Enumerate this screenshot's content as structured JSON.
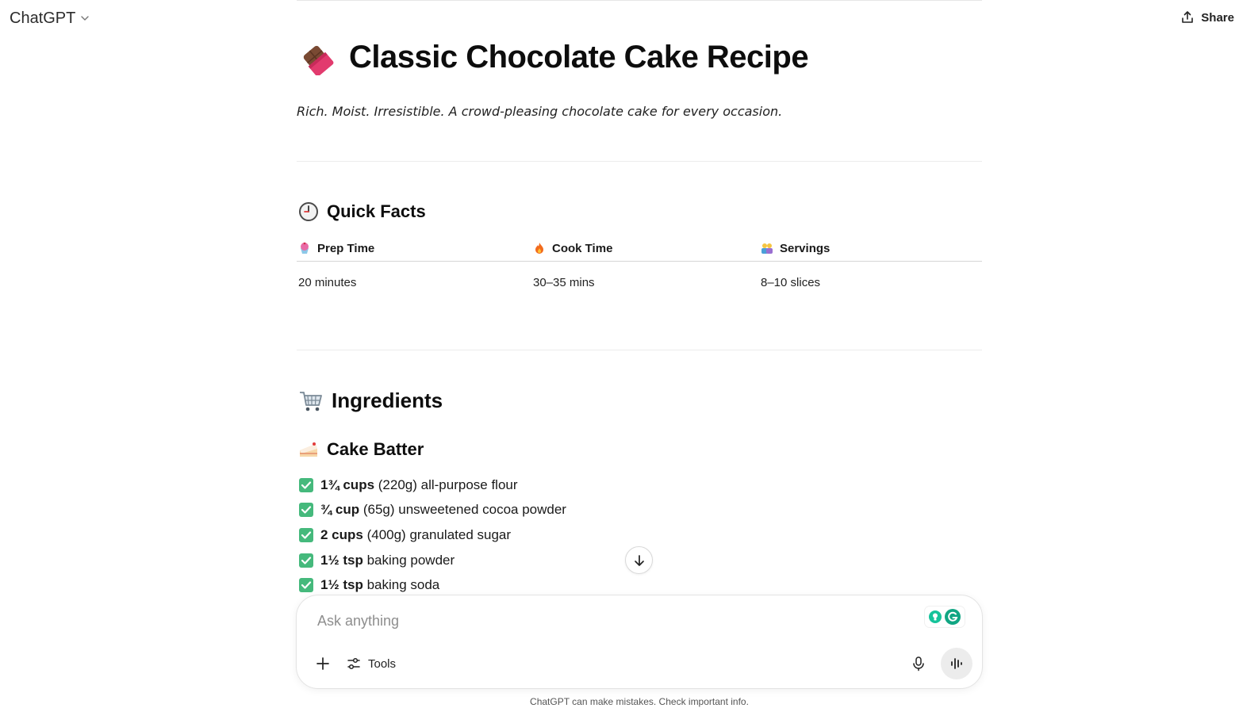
{
  "header": {
    "model_label": "ChatGPT",
    "share_label": "Share"
  },
  "doc": {
    "title": "Classic Chocolate Cake Recipe",
    "title_icon": "chocolate-bar-emoji",
    "tagline": "Rich. Moist. Irresistible. A crowd-pleasing chocolate cake for every occasion.",
    "quick_facts": {
      "heading": "Quick Facts",
      "heading_icon": "clock-emoji",
      "columns": [
        {
          "label": "Prep Time",
          "icon": "cupcake-emoji",
          "value": "20 minutes"
        },
        {
          "label": "Cook Time",
          "icon": "fire-emoji",
          "value": "30–35 mins"
        },
        {
          "label": "Servings",
          "icon": "people-emoji",
          "value": "8–10 slices"
        }
      ]
    },
    "ingredients": {
      "heading": "Ingredients",
      "heading_icon": "shopping-cart-emoji",
      "subheading": "Cake Batter",
      "subheading_icon": "cake-slice-emoji",
      "items": [
        {
          "qty": "1¾ cups",
          "rest": " (220g) all-purpose flour"
        },
        {
          "qty": "¾ cup",
          "rest": " (65g) unsweetened cocoa powder"
        },
        {
          "qty": "2 cups",
          "rest": " (400g) granulated sugar"
        },
        {
          "qty": "1½ tsp",
          "rest": " baking powder"
        },
        {
          "qty": "1½ tsp",
          "rest": " baking soda"
        }
      ]
    }
  },
  "composer": {
    "placeholder": "Ask anything",
    "tools_label": "Tools"
  },
  "footer": {
    "disclaimer": "ChatGPT can make mistakes. Check important info."
  },
  "colors": {
    "check_green": "#45b97c",
    "text": "#0d0d0d"
  }
}
